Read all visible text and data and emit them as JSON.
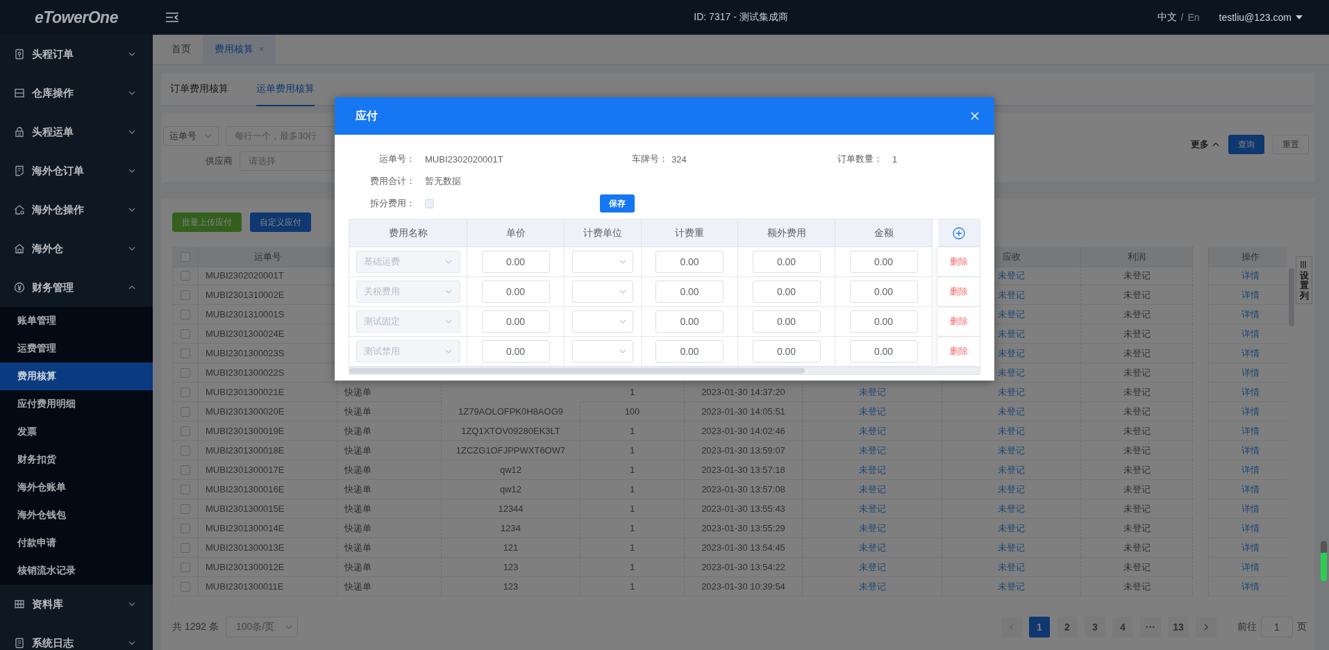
{
  "topbar": {
    "logo": "eTowerOne",
    "title": "ID: 7317 - 测试集成商",
    "languages": [
      {
        "label": "中文",
        "selected": true
      },
      {
        "label": "En",
        "selected": false
      }
    ],
    "language_separator": "/",
    "user": "testliu@123.com"
  },
  "sidebar": {
    "items": [
      {
        "label": "头程订单",
        "expanded": false
      },
      {
        "label": "仓库操作",
        "expanded": false
      },
      {
        "label": "头程运单",
        "expanded": false
      },
      {
        "label": "海外仓订单",
        "expanded": false
      },
      {
        "label": "海外仓操作",
        "expanded": false
      },
      {
        "label": "海外仓",
        "expanded": false
      },
      {
        "label": "财务管理",
        "expanded": true,
        "children": [
          {
            "label": "账单管理",
            "selected": false
          },
          {
            "label": "运费管理",
            "selected": false
          },
          {
            "label": "费用核算",
            "selected": true
          },
          {
            "label": "应付费用明细",
            "selected": false
          },
          {
            "label": "发票",
            "selected": false
          },
          {
            "label": "财务扣货",
            "selected": false
          },
          {
            "label": "海外仓账单",
            "selected": false
          },
          {
            "label": "海外仓钱包",
            "selected": false
          },
          {
            "label": "付款申请",
            "selected": false
          },
          {
            "label": "核销流水记录",
            "selected": false
          }
        ]
      },
      {
        "label": "资料库",
        "expanded": false
      },
      {
        "label": "系统日志",
        "expanded": false
      }
    ]
  },
  "page_tabs": [
    {
      "label": "首页",
      "selected": false
    },
    {
      "label": "费用核算",
      "selected": true,
      "close": "×"
    }
  ],
  "sub_tabs": [
    {
      "label": "订单费用核算",
      "selected": false
    },
    {
      "label": "运单费用核算",
      "selected": true
    }
  ],
  "filters": {
    "field_select": "运单号",
    "input_placeholder": "每行一个，最多30行",
    "supplier_label": "供应商",
    "supplier_placeholder": "请选择",
    "more": "更多",
    "search_button": "查询",
    "reset_button": "重置"
  },
  "actions": {
    "upload_button": "批量上传应付",
    "custom_button": "自定义应付"
  },
  "table": {
    "select_all": {
      "checked": false
    },
    "column_headers": {
      "waybill": "运单号",
      "receivable": "应收",
      "profit": "利润",
      "actions": "操作"
    },
    "column_settings": "设置列",
    "rows": [
      {
        "checked": false,
        "waybill": "MUBI2302020001T",
        "receivable": "未登记",
        "profit": "未登记",
        "action": "详情"
      },
      {
        "checked": false,
        "waybill": "MUBI2301310002E",
        "receivable": "未登记",
        "profit": "未登记",
        "action": "详情"
      },
      {
        "checked": false,
        "waybill": "MUBI2301310001S",
        "receivable": "未登记",
        "profit": "未登记",
        "action": "详情"
      },
      {
        "checked": false,
        "waybill": "MUBI2301300024E",
        "receivable": "未登记",
        "profit": "未登记",
        "action": "详情"
      },
      {
        "checked": false,
        "waybill": "MUBI2301300023S",
        "receivable": "未登记",
        "profit": "未登记",
        "action": "详情"
      },
      {
        "checked": false,
        "waybill": "MUBI2301300022S",
        "receivable": "未登记",
        "profit": "未登记",
        "action": "详情"
      },
      {
        "checked": false,
        "waybill": "MUBI2301300021E",
        "column_3": "快递单",
        "column_5": "1",
        "column_6": "2023-01-30 14:37:20",
        "column_7": "未登记",
        "receivable": "未登记",
        "profit": "未登记",
        "action": "详情"
      },
      {
        "checked": false,
        "waybill": "MUBI2301300020E",
        "column_3": "快递单",
        "column_4": "1Z79AOLOFPK0H8AOG9",
        "column_5": "100",
        "column_6": "2023-01-30 14:05:51",
        "column_7": "未登记",
        "receivable": "未登记",
        "profit": "未登记",
        "action": "详情"
      },
      {
        "checked": false,
        "waybill": "MUBI2301300019E",
        "column_3": "快递单",
        "column_4": "1ZQ1XTOV09280EK3LT",
        "column_5": "1",
        "column_6": "2023-01-30 14:02:46",
        "column_7": "未登记",
        "receivable": "未登记",
        "profit": "未登记",
        "action": "详情"
      },
      {
        "checked": false,
        "waybill": "MUBI2301300018E",
        "column_3": "快递单",
        "column_4": "1ZCZG1OFJPPWXT6OW7",
        "column_5": "1",
        "column_6": "2023-01-30 13:59:07",
        "column_7": "未登记",
        "receivable": "未登记",
        "profit": "未登记",
        "action": "详情"
      },
      {
        "checked": false,
        "waybill": "MUBI2301300017E",
        "column_3": "快递单",
        "column_4": "qw12",
        "column_5": "1",
        "column_6": "2023-01-30 13:57:18",
        "column_7": "未登记",
        "receivable": "未登记",
        "profit": "未登记",
        "action": "详情"
      },
      {
        "checked": false,
        "waybill": "MUBI2301300016E",
        "column_3": "快递单",
        "column_4": "qw12",
        "column_5": "1",
        "column_6": "2023-01-30 13:57:08",
        "column_7": "未登记",
        "receivable": "未登记",
        "profit": "未登记",
        "action": "详情"
      },
      {
        "checked": false,
        "waybill": "MUBI2301300015E",
        "column_3": "快递单",
        "column_4": "12344",
        "column_5": "1",
        "column_6": "2023-01-30 13:55:43",
        "column_7": "未登记",
        "receivable": "未登记",
        "profit": "未登记",
        "action": "详情"
      },
      {
        "checked": false,
        "waybill": "MUBI2301300014E",
        "column_3": "快递单",
        "column_4": "1234",
        "column_5": "1",
        "column_6": "2023-01-30 13:55:29",
        "column_7": "未登记",
        "receivable": "未登记",
        "profit": "未登记",
        "action": "详情"
      },
      {
        "checked": false,
        "waybill": "MUBI2301300013E",
        "column_3": "快递单",
        "column_4": "121",
        "column_5": "1",
        "column_6": "2023-01-30 13:54:45",
        "column_7": "未登记",
        "receivable": "未登记",
        "profit": "未登记",
        "action": "详情"
      },
      {
        "checked": false,
        "waybill": "MUBI2301300012E",
        "column_3": "快递单",
        "column_4": "123",
        "column_5": "1",
        "column_6": "2023-01-30 13:54:22",
        "column_7": "未登记",
        "receivable": "未登记",
        "profit": "未登记",
        "action": "详情"
      },
      {
        "checked": false,
        "waybill": "MUBI2301300011E",
        "column_3": "快递单",
        "column_4": "123",
        "column_5": "1",
        "column_6": "2023-01-30 10:39:54",
        "column_7": "未登记",
        "receivable": "未登记",
        "profit": "未登记",
        "action": "详情"
      }
    ]
  },
  "pagination": {
    "total": "共 1292 条",
    "page_size": "100条/页",
    "pages": [
      {
        "label": "1",
        "selected": true
      },
      {
        "label": "2",
        "selected": false
      },
      {
        "label": "3",
        "selected": false
      },
      {
        "label": "4",
        "selected": false
      },
      {
        "label": "···",
        "selected": false
      },
      {
        "label": "13",
        "selected": false
      }
    ],
    "goto_label": "前往",
    "goto_value": "1",
    "goto_suffix": "页"
  },
  "dialog": {
    "title": "应付",
    "fields": [
      {
        "label": "运单号：",
        "value": "MUBI2302020001T"
      },
      {
        "label": "车牌号：",
        "value": "324"
      },
      {
        "label": "订单数量：",
        "value": "1"
      },
      {
        "label": "费用合计：",
        "value": "暂无数据"
      }
    ],
    "split_fee": {
      "label": "拆分费用：",
      "checked": false
    },
    "save_button": "保存",
    "fee_table": {
      "columns": [
        "费用名称",
        "单价",
        "计费单位",
        "计费重",
        "额外费用",
        "金额"
      ],
      "rows": [
        {
          "name": "基础运费",
          "disabled": true,
          "unit_price": "0.00",
          "weight": "0.00",
          "extra": "0.00",
          "amount": "0.00",
          "action": "删除"
        },
        {
          "name": "关税费用",
          "disabled": true,
          "unit_price": "0.00",
          "weight": "0.00",
          "extra": "0.00",
          "amount": "0.00",
          "action": "删除"
        },
        {
          "name": "测试固定",
          "disabled": true,
          "unit_price": "0.00",
          "weight": "0.00",
          "extra": "0.00",
          "amount": "0.00",
          "action": "删除"
        },
        {
          "name": "测试禁用",
          "disabled": true,
          "unit_price": "0.00",
          "weight": "0.00",
          "extra": "0.00",
          "amount": "0.00",
          "action": "删除"
        }
      ]
    }
  }
}
